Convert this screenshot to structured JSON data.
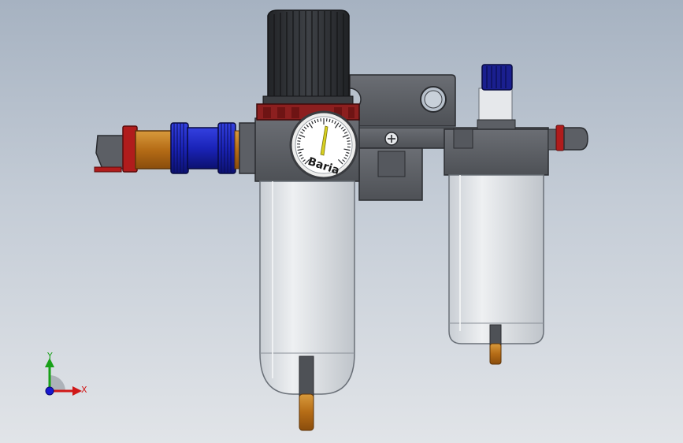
{
  "viewport": {
    "background_top": "#a6b2c1",
    "background_bottom": "#e1e4e8"
  },
  "model": {
    "gauge": {
      "brand": "Baria",
      "needle_color": "#d8d020"
    },
    "colors": {
      "body": "#5a5d63",
      "knob": "#2e3034",
      "red_ring": "#8c1f1f",
      "blue_nut": "#1a23b8",
      "orange_tube": "#c07a22",
      "bowl": "#d5d9de",
      "cap_blue": "#1a1f8f"
    }
  },
  "triad": {
    "x_label": "X",
    "y_label": "Y",
    "x_color": "#d01818",
    "y_color": "#18a018",
    "z_color": "#1818d0"
  }
}
